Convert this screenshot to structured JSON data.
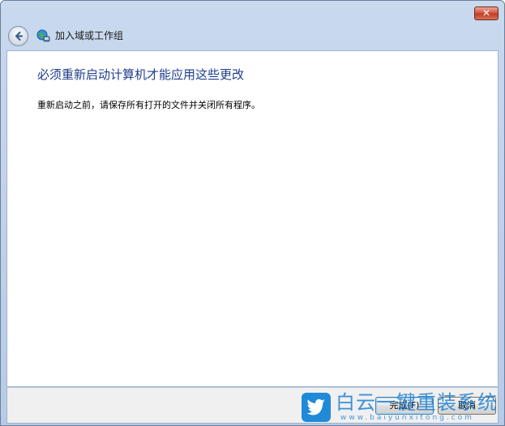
{
  "window": {
    "close_label": "✕"
  },
  "nav": {
    "title": "加入域或工作组",
    "back_icon": "back-arrow-icon",
    "wizard_icon": "network-globe-icon"
  },
  "main": {
    "heading": "必须重新启动计算机才能应用这些更改",
    "body": "重新启动之前，请保存所有打开的文件并关闭所有程序。"
  },
  "footer": {
    "finish_label": "完成(F)",
    "cancel_label": "取消"
  },
  "watermark": {
    "brand": "白云一键重装系统",
    "url": "www.baiyunxitong.com",
    "icon": "twitter-bird-icon"
  },
  "colors": {
    "heading": "#1e3c8c",
    "chrome": "#b7cbe6",
    "close": "#c23a22",
    "watermark": "#1f8ad8"
  }
}
